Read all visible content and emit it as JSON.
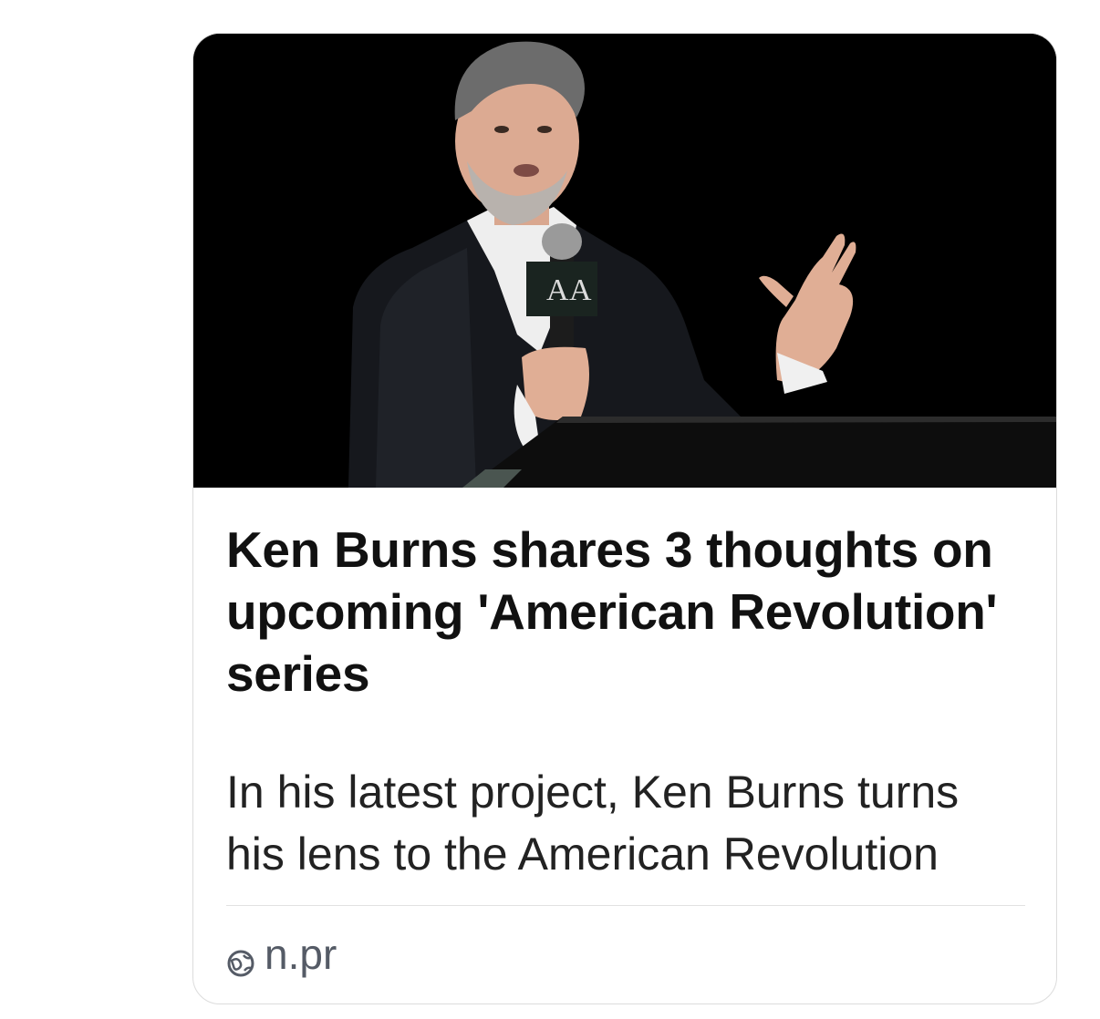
{
  "card": {
    "image_alt": "Ken Burns speaking at a podium holding a microphone",
    "headline": "Ken Burns shares 3 thoughts on upcoming 'American Revolution' series",
    "description": "In his latest project, Ken Burns turns his lens to the American Revolution",
    "source": "n.pr",
    "icons": {
      "source": "globe-icon"
    }
  }
}
